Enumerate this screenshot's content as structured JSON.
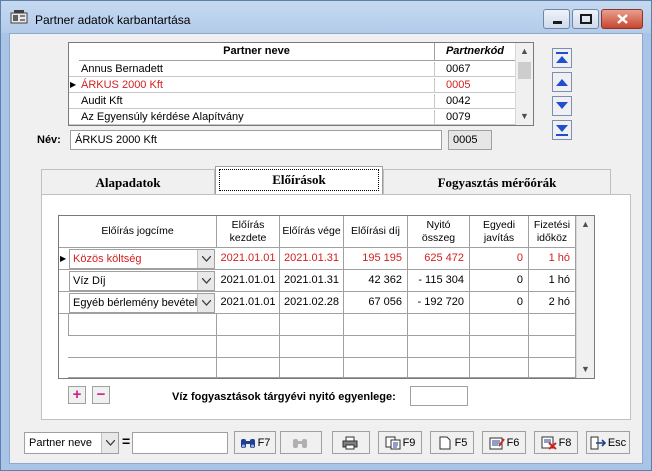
{
  "window": {
    "title": "Partner adatok karbantartása",
    "icon": "app-icon"
  },
  "partner_list": {
    "header_name": "Partner neve",
    "header_code": "Partnerkód",
    "rows": [
      {
        "name": "Annus Bernadett",
        "code": "0067",
        "selected": false
      },
      {
        "name": "ÁRKUS 2000 Kft",
        "code": "0005",
        "selected": true
      },
      {
        "name": "Audit Kft",
        "code": "0042",
        "selected": false
      },
      {
        "name": "Az Egyensúly kérdése Alapítvány",
        "code": "0079",
        "selected": false
      }
    ]
  },
  "name_field": {
    "label": "Név:",
    "value": "ÁRKUS 2000 Kft",
    "code": "0005"
  },
  "tabs": [
    {
      "label": "Alapadatok",
      "active": false
    },
    {
      "label": "Előírások",
      "active": true
    },
    {
      "label": "Fogyasztás mérőórák",
      "active": false
    }
  ],
  "grid": {
    "columns": [
      "Előírás jogcíme",
      "Előírás kezdete",
      "Előírás vége",
      "Előírási díj",
      "Nyitó összeg",
      "Egyedi javítás",
      "Fizetési időköz"
    ],
    "rows": [
      {
        "jogcim": "Közös költség",
        "kezdete": "2021.01.01",
        "vege": "2021.01.31",
        "dij": "195 195",
        "nyito": "625 472",
        "javitas": "0",
        "idokoz": "1 hó",
        "current": true
      },
      {
        "jogcim": "Víz Díj",
        "kezdete": "2021.01.01",
        "vege": "2021.01.31",
        "dij": "42 362",
        "nyito": "- 115 304",
        "javitas": "0",
        "idokoz": "1 hó",
        "current": false
      },
      {
        "jogcim": "Egyéb bérlemény bevétel",
        "kezdete": "2021.01.01",
        "vege": "2021.02.28",
        "dij": "67 056",
        "nyito": "- 192 720",
        "javitas": "0",
        "idokoz": "2 hó",
        "current": false
      }
    ]
  },
  "row_actions": {
    "add": "+",
    "remove": "−"
  },
  "water_balance": {
    "label": "Víz fogyasztások tárgyévi nyitó egyenlege:",
    "value": ""
  },
  "toolbar": {
    "search_field": "Partner neve",
    "equals": "=",
    "filter_value": "",
    "buttons": [
      {
        "label": "F7",
        "icon": "binoculars-icon"
      },
      {
        "label": "",
        "icon": "binoculars-next-icon",
        "disabled": true
      },
      {
        "label": "",
        "icon": "printer-icon"
      },
      {
        "label": "F9",
        "icon": "copy-icon"
      },
      {
        "label": "F5",
        "icon": "new-document-icon"
      },
      {
        "label": "F6",
        "icon": "edit-icon"
      },
      {
        "label": "F8",
        "icon": "delete-icon"
      },
      {
        "label": "Esc",
        "icon": "exit-icon"
      }
    ]
  },
  "colors": {
    "selected_text": "#d22020",
    "action_accent": "#d0208a",
    "nav_blue": "#1f4fd0"
  }
}
